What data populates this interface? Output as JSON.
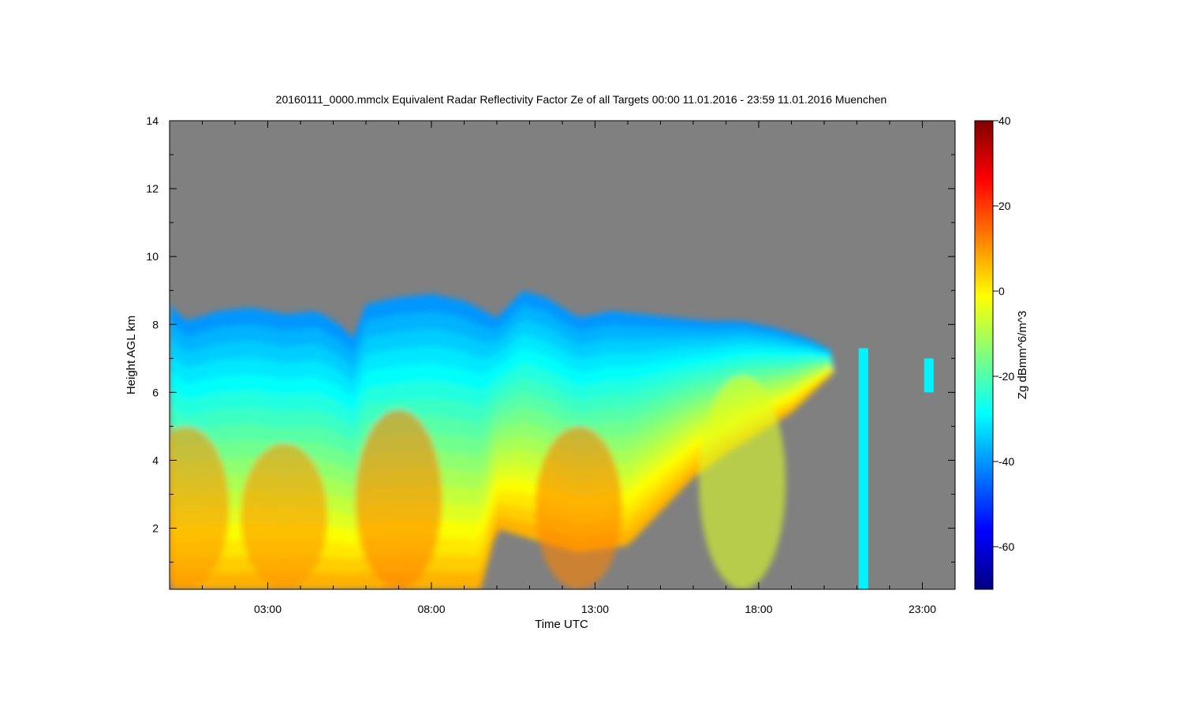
{
  "chart_data": {
    "type": "heatmap",
    "title": "20160111_0000.mmclx Equivalent Radar Reflectivity Factor Ze of all Targets   00:00 11.01.2016 - 23:59 11.01.2016 Muenchen",
    "xlabel": "Time UTC",
    "ylabel": "Height AGL km",
    "colorbar_label": "Zg dBmm^6/m^3",
    "xlim": [
      0,
      24
    ],
    "ylim": [
      0.2,
      14
    ],
    "zlim": [
      -70,
      40
    ],
    "x_ticks": [
      {
        "value": 3,
        "label": "03:00"
      },
      {
        "value": 8,
        "label": "08:00"
      },
      {
        "value": 13,
        "label": "13:00"
      },
      {
        "value": 18,
        "label": "18:00"
      },
      {
        "value": 23,
        "label": "23:00"
      }
    ],
    "y_ticks": [
      {
        "value": 2,
        "label": "2"
      },
      {
        "value": 4,
        "label": "4"
      },
      {
        "value": 6,
        "label": "6"
      },
      {
        "value": 8,
        "label": "8"
      },
      {
        "value": 10,
        "label": "10"
      },
      {
        "value": 12,
        "label": "12"
      },
      {
        "value": 14,
        "label": "14"
      }
    ],
    "colorbar_ticks": [
      {
        "value": 40,
        "label": "40"
      },
      {
        "value": 20,
        "label": "20"
      },
      {
        "value": 0,
        "label": "0"
      },
      {
        "value": -20,
        "label": "-20"
      },
      {
        "value": -40,
        "label": "-40"
      },
      {
        "value": -60,
        "label": "-60"
      }
    ],
    "no_data_color": "#808080",
    "colormap": [
      "#00007f",
      "#0000ff",
      "#007fff",
      "#00ffff",
      "#7fff7f",
      "#ffff00",
      "#ff7f00",
      "#ff0000",
      "#7f0000"
    ],
    "cloud_top_km": [
      [
        0,
        8.6
      ],
      [
        0.5,
        8.1
      ],
      [
        1.5,
        8.4
      ],
      [
        2.5,
        8.5
      ],
      [
        3.5,
        8.3
      ],
      [
        4.5,
        8.4
      ],
      [
        5.2,
        8.0
      ],
      [
        5.6,
        7.6
      ],
      [
        6.0,
        8.6
      ],
      [
        7.0,
        8.8
      ],
      [
        8.0,
        8.9
      ],
      [
        9.0,
        8.7
      ],
      [
        10.0,
        8.2
      ],
      [
        10.8,
        9.0
      ],
      [
        11.5,
        8.8
      ],
      [
        12.5,
        8.2
      ],
      [
        13.5,
        8.4
      ],
      [
        14.5,
        8.3
      ],
      [
        15.5,
        8.2
      ],
      [
        16.5,
        8.1
      ],
      [
        17.5,
        8.1
      ],
      [
        18.5,
        7.9
      ],
      [
        19.5,
        7.6
      ],
      [
        20.3,
        7.2
      ]
    ],
    "cloud_base_km": [
      [
        0,
        0.2
      ],
      [
        9.5,
        0.2
      ],
      [
        10.0,
        2.0
      ],
      [
        11.0,
        1.7
      ],
      [
        12.5,
        1.3
      ],
      [
        14.0,
        1.5
      ],
      [
        15.0,
        2.5
      ],
      [
        16.0,
        3.5
      ],
      [
        17.0,
        4.2
      ],
      [
        18.0,
        4.8
      ],
      [
        19.0,
        5.4
      ],
      [
        20.3,
        6.6
      ]
    ],
    "reflectivity_core": [
      {
        "time": 0.5,
        "top_km": 5.0,
        "max_dBZ": 10
      },
      {
        "time": 3.5,
        "top_km": 4.5,
        "max_dBZ": 10
      },
      {
        "time": 7.0,
        "top_km": 5.5,
        "max_dBZ": 12
      },
      {
        "time": 12.5,
        "top_km": 5.0,
        "max_dBZ": 12
      },
      {
        "time": 17.5,
        "top_km": 6.5,
        "max_dBZ": -5
      }
    ],
    "isolated_echoes": [
      {
        "time": 21.2,
        "bottom_km": 0.2,
        "top_km": 7.3
      },
      {
        "time": 23.2,
        "bottom_km": 6.0,
        "top_km": 7.0
      }
    ]
  }
}
